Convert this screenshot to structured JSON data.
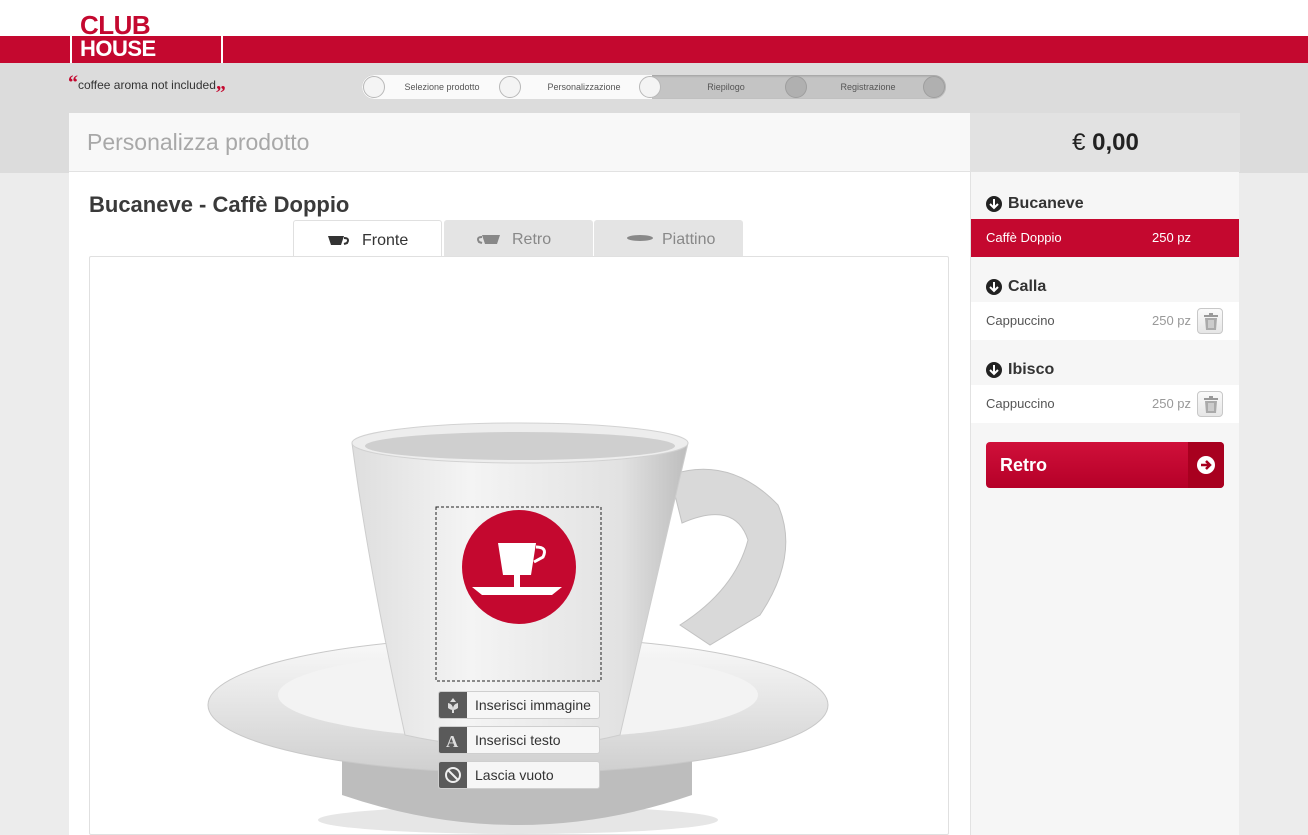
{
  "brand": {
    "line1": "CLUB",
    "line2": "HOUSE",
    "tagline": "coffee aroma not included"
  },
  "steps": [
    "Selezione prodotto",
    "Personalizzazione",
    "Riepilogo",
    "Registrazione"
  ],
  "panel": {
    "title": "Personalizza prodotto"
  },
  "price": {
    "currency": "€",
    "amount": "0,00"
  },
  "product": {
    "title": "Bucaneve - Caffè Doppio"
  },
  "tabs": [
    {
      "label": "Fronte",
      "icon": "cup-front-icon"
    },
    {
      "label": "Retro",
      "icon": "cup-back-icon"
    },
    {
      "label": "Piattino",
      "icon": "saucer-icon"
    }
  ],
  "actions": {
    "insert_image": "Inserisci immagine",
    "insert_text": "Inserisci testo",
    "leave_empty": "Lascia vuoto"
  },
  "sidebar": {
    "groups": [
      {
        "name": "Bucaneve",
        "item": "Caffè Doppio",
        "qty": "250 pz",
        "selected": true
      },
      {
        "name": "Calla",
        "item": "Cappuccino",
        "qty": "250 pz",
        "selected": false
      },
      {
        "name": "Ibisco",
        "item": "Cappuccino",
        "qty": "250 pz",
        "selected": false
      }
    ],
    "button_label": "Retro"
  },
  "colors": {
    "accent": "#c4082f"
  }
}
